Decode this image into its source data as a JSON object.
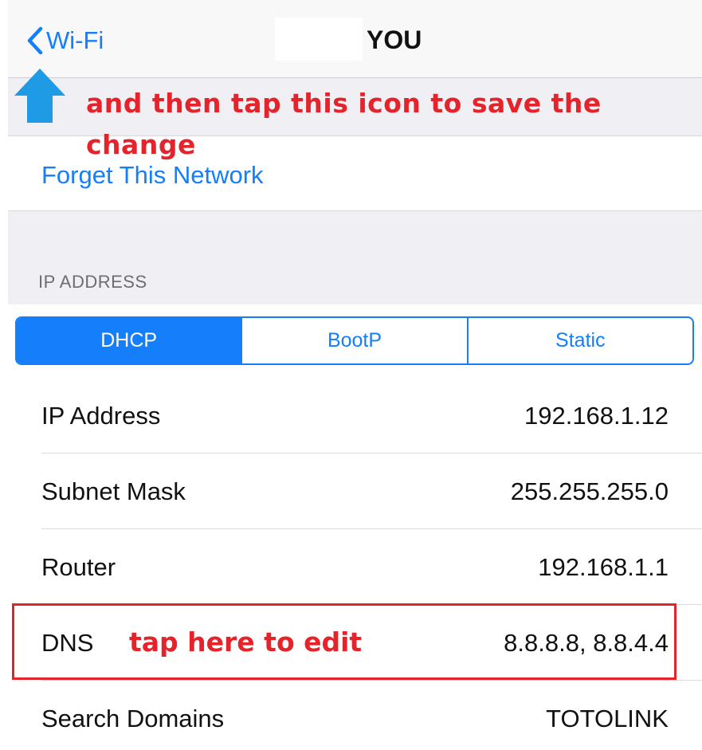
{
  "navbar": {
    "back_label": "Wi-Fi",
    "title": "YOU"
  },
  "annotations": {
    "save_line1": "and then tap this icon to save the",
    "save_line2": "change",
    "edit_hint": "tap here to edit"
  },
  "forget_network": {
    "label": "Forget This Network"
  },
  "ip_section": {
    "header": "IP ADDRESS",
    "segments": [
      "DHCP",
      "BootP",
      "Static"
    ],
    "selected": "DHCP"
  },
  "rows": [
    {
      "label": "IP Address",
      "value": "192.168.1.12"
    },
    {
      "label": "Subnet Mask",
      "value": "255.255.255.0"
    },
    {
      "label": "Router",
      "value": "192.168.1.1"
    },
    {
      "label": "DNS",
      "value": "8.8.8.8, 8.8.4.4"
    },
    {
      "label": "Search Domains",
      "value": "TOTOLINK"
    }
  ],
  "colors": {
    "accent": "#147efb",
    "annotation": "#e5232a",
    "arrow": "#1f9be6"
  }
}
